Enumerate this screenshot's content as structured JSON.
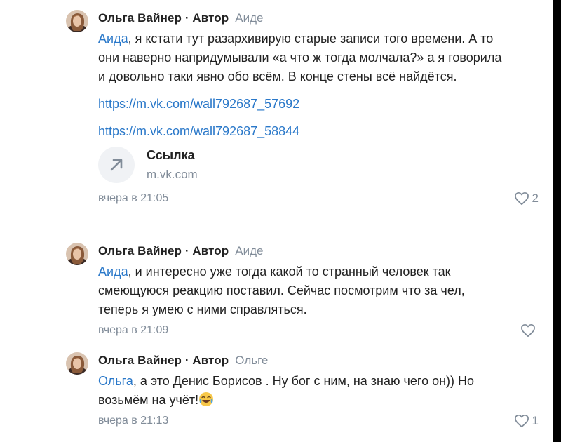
{
  "comments": [
    {
      "author": "Ольга Вайнер · Автор",
      "reply_to": "Аиде",
      "mention": "Аида",
      "text": ", я кстати тут разархивирую старые записи того времени. А то\nони наверно напридумывали «а что ж тогда молчала?» а я говорила\nи довольно таки явно обо всём. В конце стены всё найдётся.",
      "links": [
        "https://m.vk.com/wall792687_57692",
        "https://m.vk.com/wall792687_58844"
      ],
      "card": {
        "title": "Ссылка",
        "domain": "m.vk.com",
        "icon": "arrow-up-right-icon"
      },
      "time": "вчера в 21:05",
      "likes": "2"
    },
    {
      "author": "Ольга Вайнер · Автор",
      "reply_to": "Аиде",
      "mention": "Аида",
      "text": ", и интересно уже тогда какой то странный человек так\nсмеющуюся реакцию поставил. Сейчас посмотрим что за чел,\nтеперь я умею с ними справляться.",
      "time": "вчера в 21:09",
      "likes": ""
    },
    {
      "author": "Ольга Вайнер · Автор",
      "reply_to": "Ольге",
      "mention": "Ольга",
      "text": ", а это Денис Борисов . Ну бог с ним, на знаю чего он)) Но\nвозьмём на учёт!",
      "emoji": "tears-of-joy-emoji",
      "time": "вчера в 21:13",
      "likes": "1"
    }
  ],
  "colors": {
    "link": "#2a78c9",
    "secondary": "#818c99",
    "text": "#222222",
    "background": "#ffffff"
  }
}
